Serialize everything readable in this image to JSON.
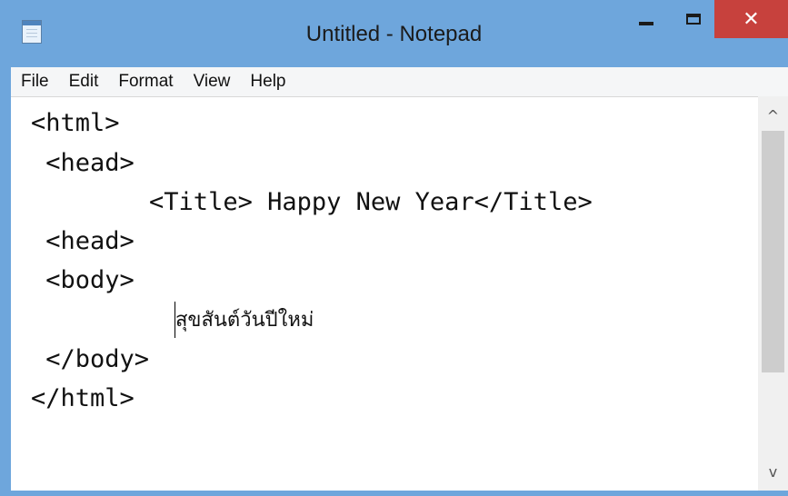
{
  "window": {
    "title": "Untitled - Notepad",
    "close_glyph": "✕"
  },
  "menu": {
    "items": [
      "File",
      "Edit",
      "Format",
      "View",
      "Help"
    ]
  },
  "editor": {
    "lines": [
      "<html>",
      " <head>",
      "        <Title> Happy New Year</Title>",
      " <head>",
      " <body>",
      "สุขสันต์วันปีใหม่",
      " </body>",
      "</html>"
    ]
  },
  "scrollbar": {
    "up_glyph": "^",
    "down_glyph": "v"
  },
  "colors": {
    "titlebar": "#6ea6dc",
    "close_button": "#c7413d"
  }
}
